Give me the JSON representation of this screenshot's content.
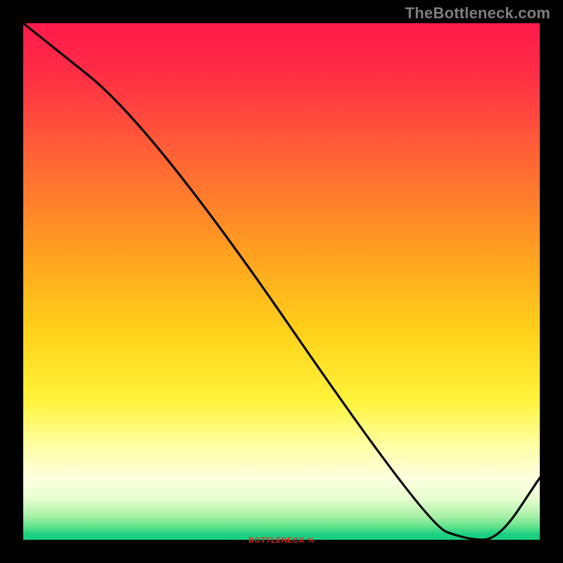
{
  "watermark": "TheBottleneck.com",
  "bottom_label": "BOTTLENECK %",
  "chart_data": {
    "type": "line",
    "title": "",
    "xlabel": "",
    "ylabel": "",
    "xlim": [
      0,
      100
    ],
    "ylim": [
      0,
      100
    ],
    "series": [
      {
        "name": "curve",
        "x": [
          0,
          25,
          78,
          86,
          92,
          100
        ],
        "y": [
          100,
          80,
          3,
          0,
          0,
          12
        ]
      }
    ],
    "gradient_stops": [
      {
        "offset": 0.0,
        "color": "#ff1a4b"
      },
      {
        "offset": 0.1,
        "color": "#ff2e45"
      },
      {
        "offset": 0.28,
        "color": "#ff6a33"
      },
      {
        "offset": 0.45,
        "color": "#ffa21f"
      },
      {
        "offset": 0.6,
        "color": "#ffd21a"
      },
      {
        "offset": 0.73,
        "color": "#fff33a"
      },
      {
        "offset": 0.82,
        "color": "#ffffa6"
      },
      {
        "offset": 0.88,
        "color": "#ffffe0"
      },
      {
        "offset": 0.92,
        "color": "#e8ffd0"
      },
      {
        "offset": 0.955,
        "color": "#a6f0a6"
      },
      {
        "offset": 0.975,
        "color": "#5fe28a"
      },
      {
        "offset": 0.99,
        "color": "#18cf82"
      },
      {
        "offset": 1.0,
        "color": "#18cf82"
      }
    ]
  }
}
